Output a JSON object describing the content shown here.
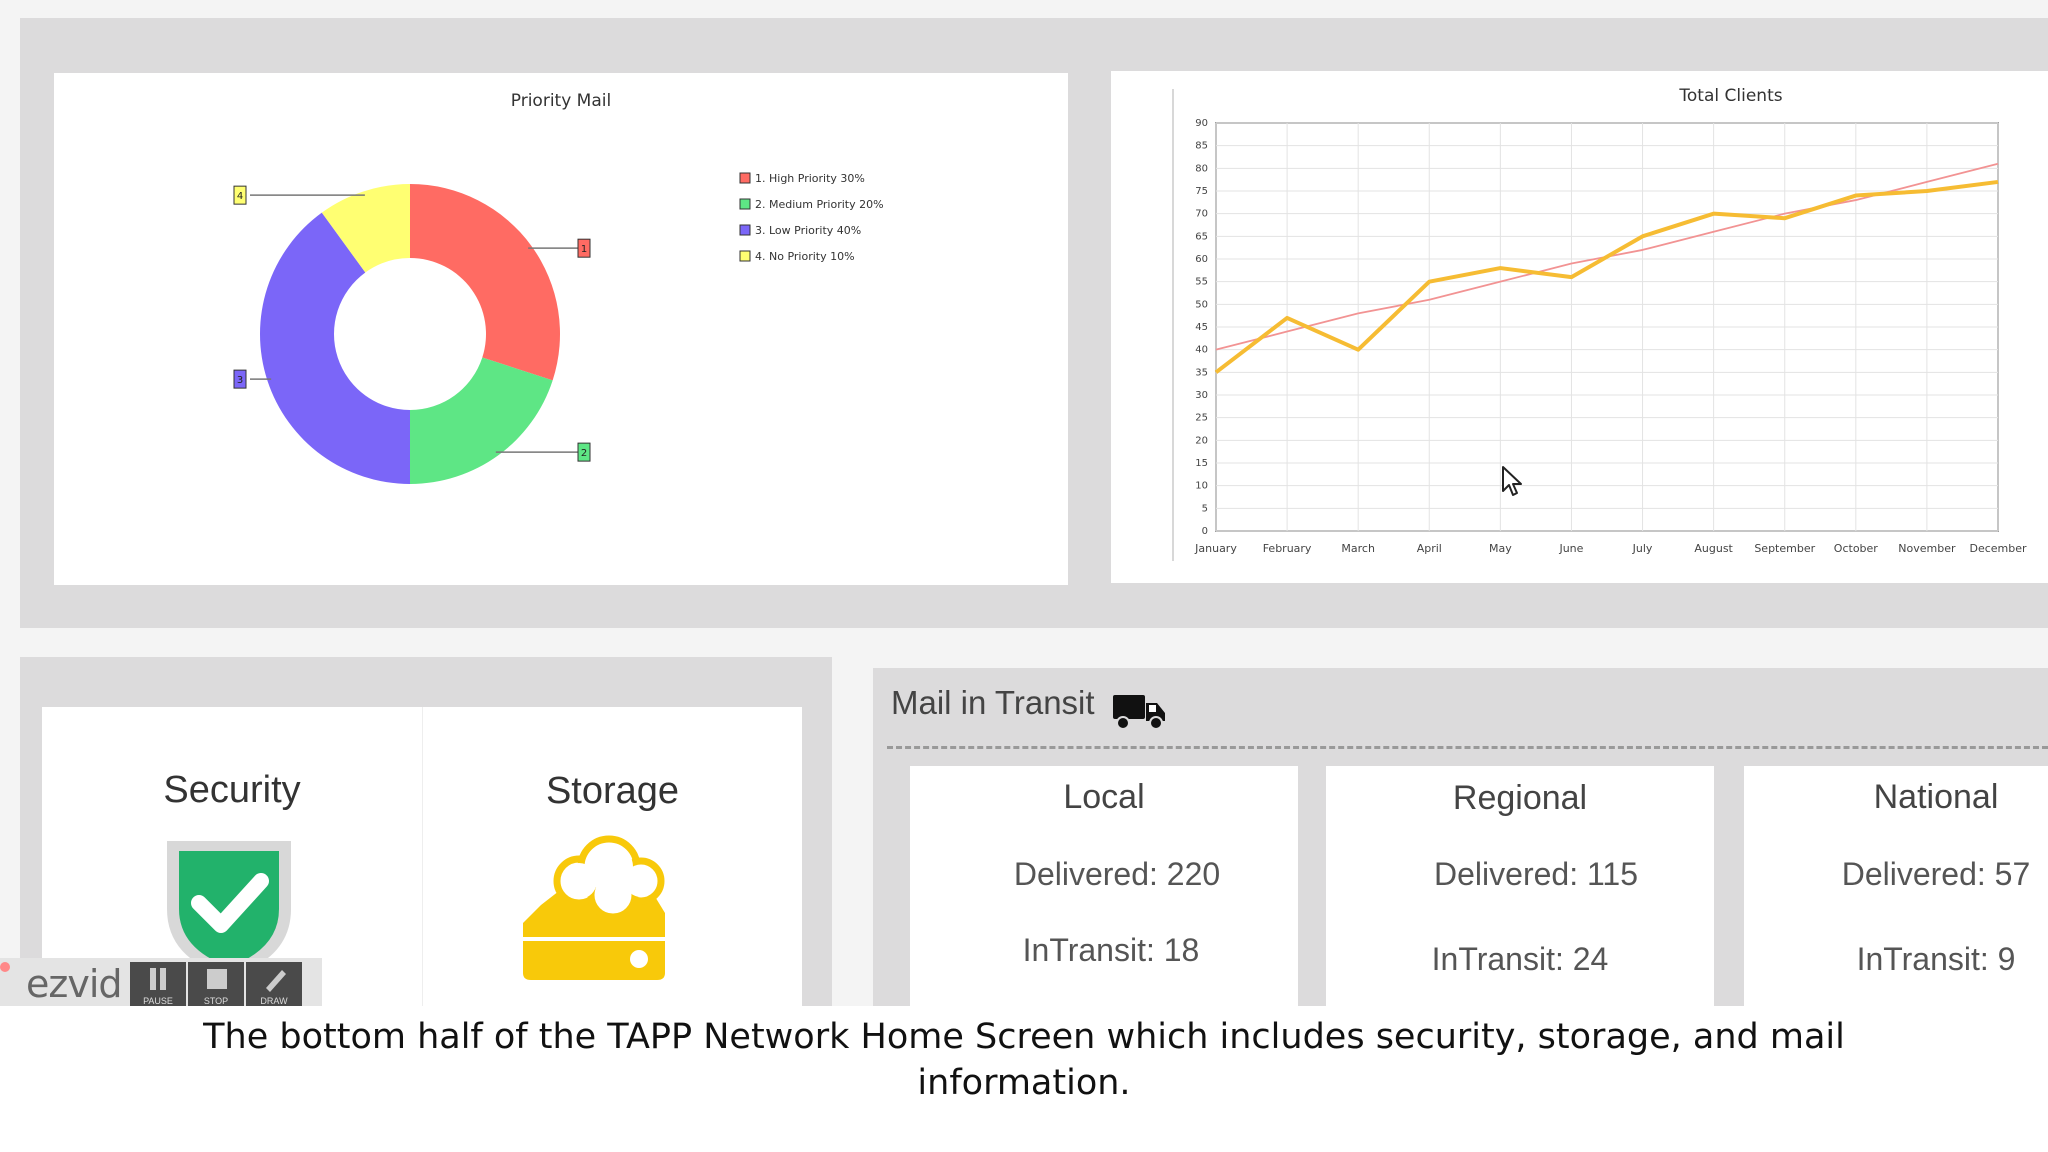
{
  "priority_chart": {
    "title": "Priority Mail",
    "legend": [
      {
        "label": "1. High Priority 30%",
        "color": "#ff6b63"
      },
      {
        "label": "2. Medium Priority 20%",
        "color": "#5ee685"
      },
      {
        "label": "3. Low Priority 40%",
        "color": "#7b66f8"
      },
      {
        "label": "4. No Priority 10%",
        "color": "#ffff72"
      }
    ],
    "marker_labels": [
      "1",
      "2",
      "3",
      "4"
    ]
  },
  "clients_chart": {
    "title": "Total Clients"
  },
  "chart_data": [
    {
      "type": "pie",
      "title": "Priority Mail",
      "categories": [
        "1. High Priority 30%",
        "2. Medium Priority 20%",
        "3. Low Priority 40%",
        "4. No Priority 10%"
      ],
      "values": [
        30,
        20,
        40,
        10
      ],
      "colors": [
        "#ff6b63",
        "#5ee685",
        "#7b66f8",
        "#ffff72"
      ],
      "donut": true,
      "legend": "right"
    },
    {
      "type": "line",
      "title": "Total Clients",
      "categories": [
        "January",
        "February",
        "March",
        "April",
        "May",
        "June",
        "July",
        "August",
        "September",
        "October",
        "November",
        "December"
      ],
      "series": [
        {
          "values": [
            35,
            47,
            40,
            55,
            58,
            56,
            65,
            70,
            69,
            74,
            75,
            77
          ],
          "color": "#f6bc33"
        },
        {
          "values": [
            40,
            44,
            48,
            51,
            55,
            59,
            62,
            66,
            70,
            73,
            77,
            81
          ],
          "color": "#f29393"
        }
      ],
      "ylim": [
        0,
        90
      ],
      "yticks": [
        0,
        5,
        10,
        15,
        20,
        25,
        30,
        35,
        40,
        45,
        50,
        55,
        60,
        65,
        70,
        75,
        80,
        85,
        90
      ],
      "grid": true
    }
  ],
  "tiles": {
    "security_label": "Security",
    "storage_label": "Storage"
  },
  "transit": {
    "header": "Mail in Transit",
    "cards": [
      {
        "title": "Local",
        "delivered": "Delivered: 220",
        "intransit": "InTransit:  18"
      },
      {
        "title": "Regional",
        "delivered": "Delivered: 115",
        "intransit": "InTransit:  24"
      },
      {
        "title": "National",
        "delivered": "Delivered: 57",
        "intransit": "InTransit:  9"
      }
    ]
  },
  "recorder": {
    "logo": "ezvid",
    "buttons": [
      "PAUSE",
      "STOP",
      "DRAW"
    ]
  },
  "caption": {
    "line1": "The bottom half of the TAPP Network Home Screen which includes security, storage, and mail",
    "line2": "information."
  },
  "icons": {
    "security": "shield-check-icon",
    "storage": "cloud-storage-icon",
    "transit": "truck-icon",
    "cursor": "mouse-pointer-icon"
  }
}
